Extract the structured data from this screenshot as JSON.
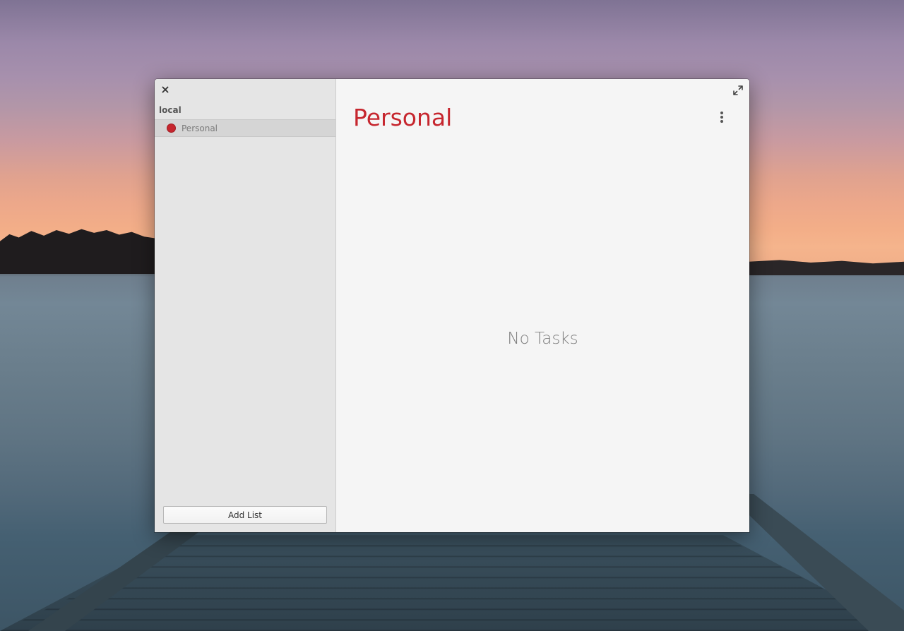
{
  "window": {
    "close_icon": "close-icon",
    "maximize_icon": "maximize-icon"
  },
  "sidebar": {
    "section_label": "local",
    "items": [
      {
        "label": "Personal",
        "color": "#c6262e",
        "selected": true
      }
    ],
    "add_list_label": "Add List"
  },
  "main": {
    "title": "Personal",
    "title_color": "#c6262e",
    "menu_icon": "more-vertical-icon",
    "empty_text": "No Tasks"
  }
}
